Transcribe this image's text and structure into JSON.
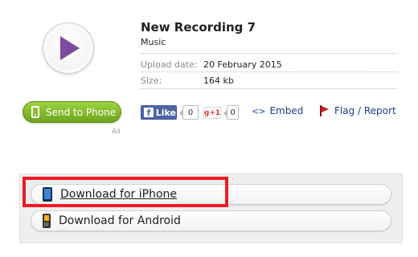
{
  "player": {
    "play_icon": "play-triangle-icon",
    "accent": "#7d4b9e"
  },
  "recording": {
    "title": "New Recording 7",
    "category": "Music",
    "upload_label": "Upload date:",
    "upload_value": "20 February 2015",
    "size_label": "Size:",
    "size_value": "164 kb"
  },
  "send": {
    "label": "Send to Phone",
    "ad": "Ad",
    "color": "#7fb52a"
  },
  "social": {
    "fb_icon": "f",
    "fb_label": "Like",
    "fb_count": "0",
    "gplus_label": "g+1",
    "gplus_count": "0",
    "embed_icon": "<>",
    "embed_label": "Embed",
    "flag_label": "Flag / Report"
  },
  "downloads": [
    {
      "label": "Download for iPhone",
      "icon": "iphone-icon",
      "highlighted": true
    },
    {
      "label": "Download for Android",
      "icon": "android-phone-icon",
      "highlighted": false
    }
  ],
  "highlight_color": "#ee1c25"
}
